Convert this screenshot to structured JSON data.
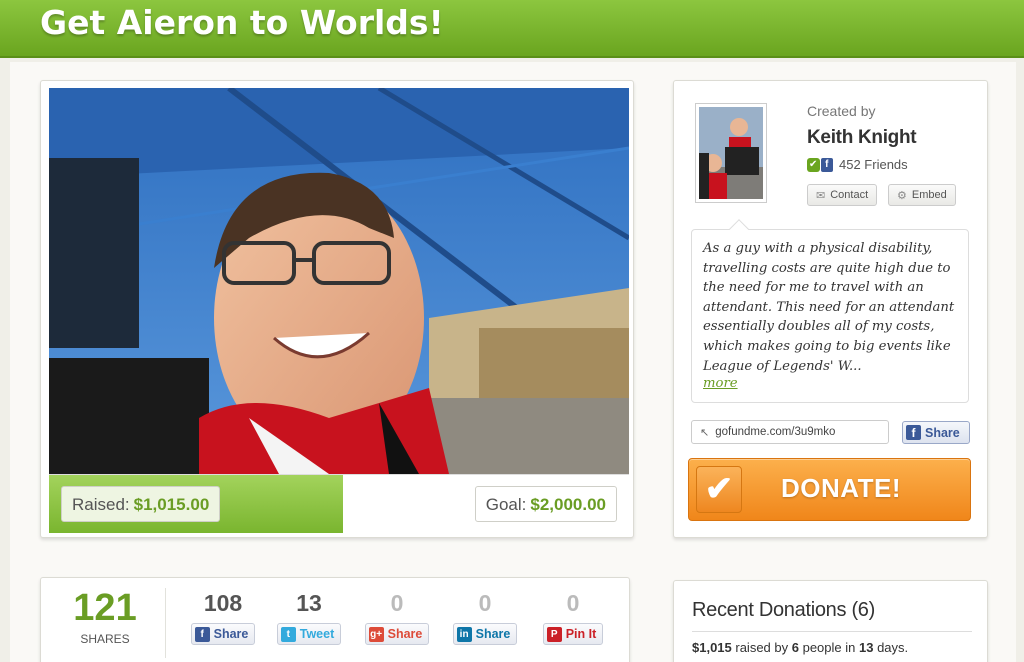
{
  "campaign": {
    "title": "Get Aieron to Worlds!"
  },
  "progress": {
    "raised_label": "Raised:",
    "raised_amount": "$1,015.00",
    "goal_label": "Goal:",
    "goal_amount": "$2,000.00",
    "fraction": 0.5075
  },
  "creator": {
    "created_by_label": "Created by",
    "name": "Keith Knight",
    "friends": "452 Friends",
    "contact_label": "Contact",
    "embed_label": "Embed",
    "blurb": "As a guy with a physical disability, travelling costs are quite high due to the need for me to travel with an attendant. This need for an attendant essentially doubles all of my costs, which makes going to big events like League of Legends' W...",
    "more_label": "more",
    "short_url": "gofundme.com/3u9mko",
    "fb_share_label": "Share",
    "donate_label": "DONATE!"
  },
  "shares": {
    "total": "121",
    "total_label": "SHARES",
    "buttons": [
      {
        "count": "108",
        "label": "Share",
        "icon": "facebook-icon",
        "color": "#3b5998"
      },
      {
        "count": "13",
        "label": "Tweet",
        "icon": "twitter-icon",
        "color": "#33aadd"
      },
      {
        "count": "0",
        "label": "Share",
        "icon": "google-plus-icon",
        "color": "#dd4b39"
      },
      {
        "count": "0",
        "label": "Share",
        "icon": "linkedin-icon",
        "color": "#0e76a8"
      },
      {
        "count": "0",
        "label": "Pin It",
        "icon": "pinterest-icon",
        "color": "#cb2027"
      }
    ]
  },
  "donations": {
    "title": "Recent Donations (6)",
    "summary_amount": "$1,015",
    "summary_mid1": " raised by ",
    "summary_people": "6",
    "summary_mid2": " people in ",
    "summary_days": "13",
    "summary_end": " days."
  },
  "colors": {
    "brand_green": "#7ab52f",
    "donate_orange": "#f59a2a"
  }
}
